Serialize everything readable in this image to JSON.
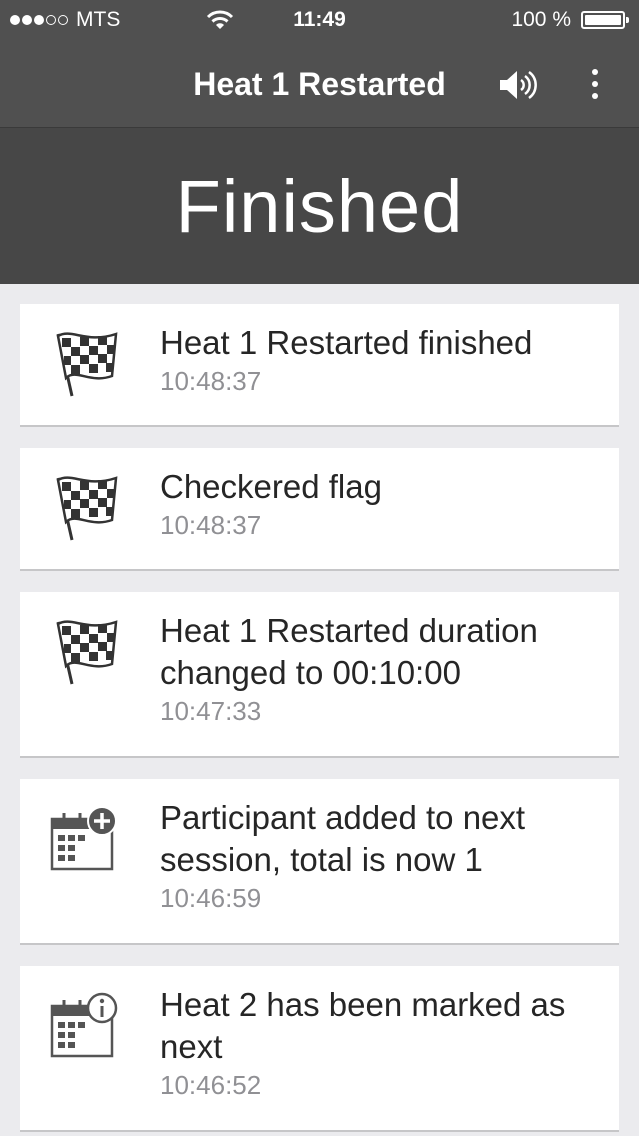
{
  "status_bar": {
    "carrier": "MTS",
    "signal_bars_filled": 3,
    "signal_bars_total": 5,
    "time": "11:49",
    "battery": "100 %"
  },
  "nav": {
    "title": "Heat 1 Restarted",
    "sound_icon": "speaker-icon",
    "menu_icon": "more-vertical-icon"
  },
  "hero": {
    "status": "Finished"
  },
  "events": [
    {
      "icon": "checkered-flag-icon",
      "message": "Heat 1 Restarted finished",
      "time": "10:48:37"
    },
    {
      "icon": "checkered-flag-icon",
      "message": "Checkered flag",
      "time": "10:48:37"
    },
    {
      "icon": "checkered-flag-icon",
      "message": "Heat 1 Restarted duration changed to 00:10:00",
      "time": "10:47:33"
    },
    {
      "icon": "calendar-add-icon",
      "message": "Participant added to next session, total is now 1",
      "time": "10:46:59"
    },
    {
      "icon": "calendar-info-icon",
      "message": "Heat 2 has been marked as next",
      "time": "10:46:52"
    }
  ]
}
